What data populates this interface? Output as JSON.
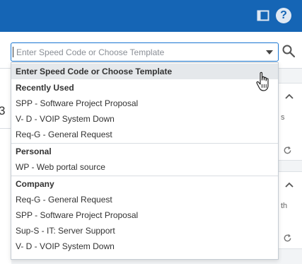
{
  "combo": {
    "placeholder": "Enter Speed Code or Choose Template"
  },
  "dropdown": {
    "first_item": "Enter Speed Code or Choose Template",
    "groups": [
      {
        "header": "Recently Used",
        "items": [
          "SPP - Software Project Proposal",
          "V- D - VOIP System Down",
          "Req-G - General Request"
        ]
      },
      {
        "header": "Personal",
        "items": [
          "WP - Web portal source"
        ]
      },
      {
        "header": "Company",
        "items": [
          "Req-G - General Request",
          "SPP - Software Project Proposal",
          "Sup-S - IT: Server Support",
          "V- D - VOIP System Down"
        ]
      }
    ]
  },
  "background": {
    "left_digit": "3",
    "card1_frag": "s",
    "card2_frag": "th"
  },
  "colors": {
    "topbar": "#1565b5",
    "accent_border": "#1976d2",
    "highlight": "#e5e8eb"
  },
  "icons": [
    "sidebar-toggle-icon",
    "help-icon",
    "search-icon",
    "chevron-up-icon",
    "refresh-icon",
    "dropdown-arrow-icon",
    "hand-cursor-icon"
  ]
}
